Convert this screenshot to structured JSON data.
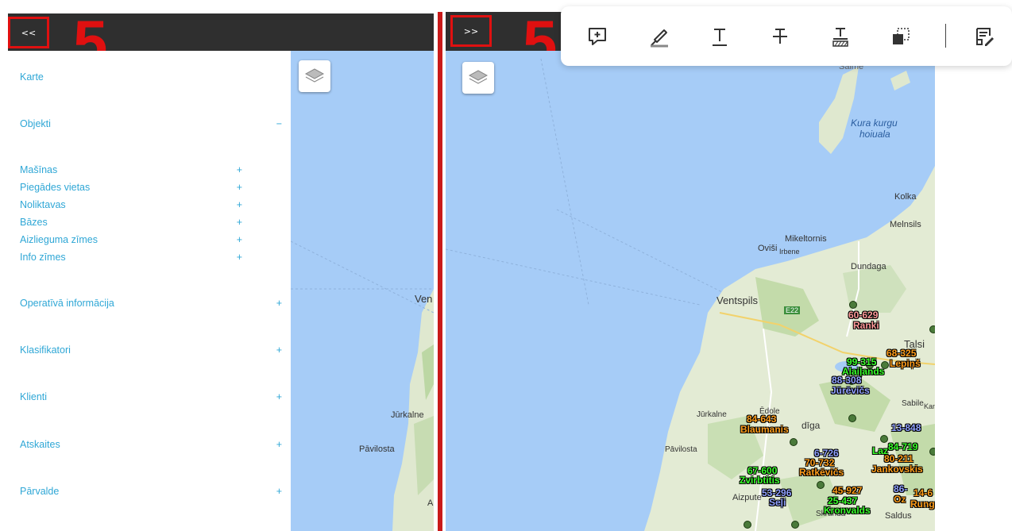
{
  "left_panel": {
    "collapse_button_label": "<<",
    "annotation_number": "5",
    "menu": [
      {
        "label": "Karte",
        "sign": ""
      },
      {
        "label": "Objekti",
        "sign": "−"
      },
      {
        "label": "Operatīvā informācija",
        "sign": "+"
      },
      {
        "label": "Klasifikatori",
        "sign": "+"
      },
      {
        "label": "Klienti",
        "sign": "+"
      },
      {
        "label": "Atskaites",
        "sign": "+"
      },
      {
        "label": "Pārvalde",
        "sign": "+"
      }
    ],
    "submenu": [
      {
        "label": "Mašīnas",
        "sign": "+"
      },
      {
        "label": "Piegādes vietas",
        "sign": "+"
      },
      {
        "label": "Noliktavas",
        "sign": "+"
      },
      {
        "label": "Bāzes",
        "sign": "+"
      },
      {
        "label": "Aizlieguma zīmes",
        "sign": "+"
      },
      {
        "label": "Info zīmes",
        "sign": "+"
      }
    ],
    "map_labels": [
      "Ven",
      "Jūrkalne",
      "Pāvilosta",
      "A"
    ]
  },
  "right_panel": {
    "expand_button_label": ">>",
    "annotation_number": "5",
    "map_labels": {
      "saime": "Saime",
      "kura_kurgu": "Kura kurgu",
      "hoiuala": "hoiuala",
      "kolka": "Kolka",
      "melnsils": "Melnsils",
      "mikeltornis": "Mikeltornis",
      "ovisi": "Oviši",
      "irbene": "Irbene",
      "dundaga": "Dundaga",
      "ventspils": "Ventspils",
      "e22": "E22",
      "talsi": "Talsi",
      "sabile": "Sabile",
      "kan": "Kan",
      "jurkalne": "Jūrkalne",
      "edole": "Ēdole",
      "kuldiga": "dīga",
      "pavilosta": "Pāvilosta",
      "aizpute": "Aizpute",
      "skrunda": "Skrunda",
      "saldus": "Saldus"
    },
    "markers": [
      {
        "text": "60-629",
        "color": "red"
      },
      {
        "text": "Ranki",
        "color": "red"
      },
      {
        "text": "68-325",
        "color": "orange"
      },
      {
        "text": "99-315",
        "color": "green"
      },
      {
        "text": "Lepiņš",
        "color": "orange"
      },
      {
        "text": "Alaiļands",
        "color": "green"
      },
      {
        "text": "88-308",
        "color": "blue"
      },
      {
        "text": "Jūrēvičs",
        "color": "blue"
      },
      {
        "text": "84-643",
        "color": "orange"
      },
      {
        "text": "Blaumanis",
        "color": "orange"
      },
      {
        "text": "13-848",
        "color": "blue"
      },
      {
        "text": "84-719",
        "color": "green"
      },
      {
        "text": "Laz",
        "color": "green"
      },
      {
        "text": "80-211",
        "color": "orange"
      },
      {
        "text": "Jankovskis",
        "color": "orange"
      },
      {
        "text": "6-726",
        "color": "blue"
      },
      {
        "text": "70-732",
        "color": "orange"
      },
      {
        "text": "Ratkēvičs",
        "color": "orange"
      },
      {
        "text": "67-600",
        "color": "green"
      },
      {
        "text": "Zvirbtitis",
        "color": "green"
      },
      {
        "text": "45-927",
        "color": "orange"
      },
      {
        "text": "25-437",
        "color": "green"
      },
      {
        "text": "53-296",
        "color": "blue"
      },
      {
        "text": "Seļi",
        "color": "blue"
      },
      {
        "text": "Kronvalds",
        "color": "green"
      },
      {
        "text": "86-",
        "color": "blue"
      },
      {
        "text": "14-6",
        "color": "orange"
      },
      {
        "text": "Oz",
        "color": "orange"
      },
      {
        "text": "Rung",
        "color": "orange"
      }
    ]
  },
  "annotation_toolbar": {
    "tools": [
      {
        "icon": "add-comment-icon"
      },
      {
        "icon": "highlighter-icon"
      },
      {
        "icon": "underline-text-icon"
      },
      {
        "icon": "strikethrough-text-icon"
      },
      {
        "icon": "squiggly-text-icon"
      },
      {
        "icon": "area-select-icon"
      },
      {
        "icon": "edit-note-icon"
      }
    ]
  }
}
